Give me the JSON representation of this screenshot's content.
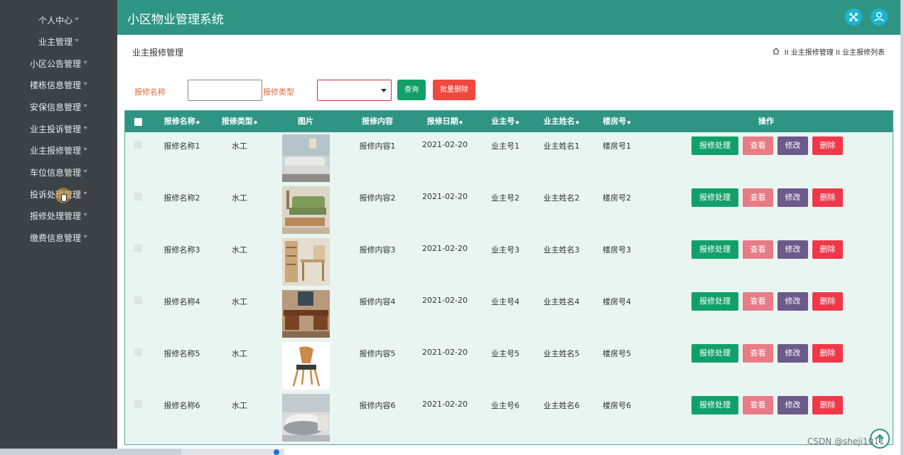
{
  "app_title": "小区物业管理系统",
  "sidebar": {
    "items": [
      {
        "label": "个人中心"
      },
      {
        "label": "业主管理"
      },
      {
        "label": "小区公告管理"
      },
      {
        "label": "楼栋信息管理"
      },
      {
        "label": "安保信息管理"
      },
      {
        "label": "业主投诉管理"
      },
      {
        "label": "业主报修管理"
      },
      {
        "label": "车位信息管理"
      },
      {
        "label": "投诉处理管理"
      },
      {
        "label": "报修处理管理"
      },
      {
        "label": "缴费信息管理"
      }
    ]
  },
  "header": {
    "icons": [
      "expand-icon",
      "user-icon"
    ]
  },
  "page": {
    "title": "业主报修管理",
    "breadcrumb": [
      "业主报修管理",
      "业主报修列表"
    ]
  },
  "search": {
    "name_label": "报修名称",
    "name_value": "",
    "type_label": "报修类型",
    "type_value": "",
    "query_button": "查询",
    "batch_delete_button": "批量删除"
  },
  "table": {
    "headers": [
      "报修名称",
      "报修类型",
      "图片",
      "报修内容",
      "报修日期",
      "业主号",
      "业主姓名",
      "楼房号",
      "操作"
    ],
    "actions": {
      "handle": "报修处理",
      "view": "查看",
      "edit": "修改",
      "delete": "删除"
    },
    "rows": [
      {
        "name": "报修名称1",
        "type": "水工",
        "content": "报修内容1",
        "date": "2021-02-20",
        "owner_no": "业主号1",
        "owner_name": "业主姓名1",
        "building": "楼房号1",
        "image": "sofa-sectional"
      },
      {
        "name": "报修名称2",
        "type": "水工",
        "content": "报修内容2",
        "date": "2021-02-20",
        "owner_no": "业主号2",
        "owner_name": "业主姓名2",
        "building": "楼房号2",
        "image": "green-sofa"
      },
      {
        "name": "报修名称3",
        "type": "水工",
        "content": "报修内容3",
        "date": "2021-02-20",
        "owner_no": "业主号3",
        "owner_name": "业主姓名3",
        "building": "楼房号3",
        "image": "bookshelf-desk"
      },
      {
        "name": "报修名称4",
        "type": "水工",
        "content": "报修内容4",
        "date": "2021-02-20",
        "owner_no": "业主号4",
        "owner_name": "业主姓名4",
        "building": "楼房号4",
        "image": "wooden-desk"
      },
      {
        "name": "报修名称5",
        "type": "水工",
        "content": "报修内容5",
        "date": "2021-02-20",
        "owner_no": "业主号5",
        "owner_name": "业主姓名5",
        "building": "楼房号5",
        "image": "wooden-chair"
      },
      {
        "name": "报修名称6",
        "type": "水工",
        "content": "报修内容6",
        "date": "2021-02-20",
        "owner_no": "业主号6",
        "owner_name": "业主姓名6",
        "building": "楼房号6",
        "image": "round-sofa"
      }
    ]
  },
  "watermark": "CSDN @sheji1011",
  "colors": {
    "sidebar_bg": "#3d4246",
    "header_bg": "#2e9585",
    "table_bg": "#e8f5f0",
    "handle_button": "#12a06a",
    "view_button": "#e87c86",
    "edit_button": "#6b5a8a",
    "delete_button": "#f0384a"
  }
}
